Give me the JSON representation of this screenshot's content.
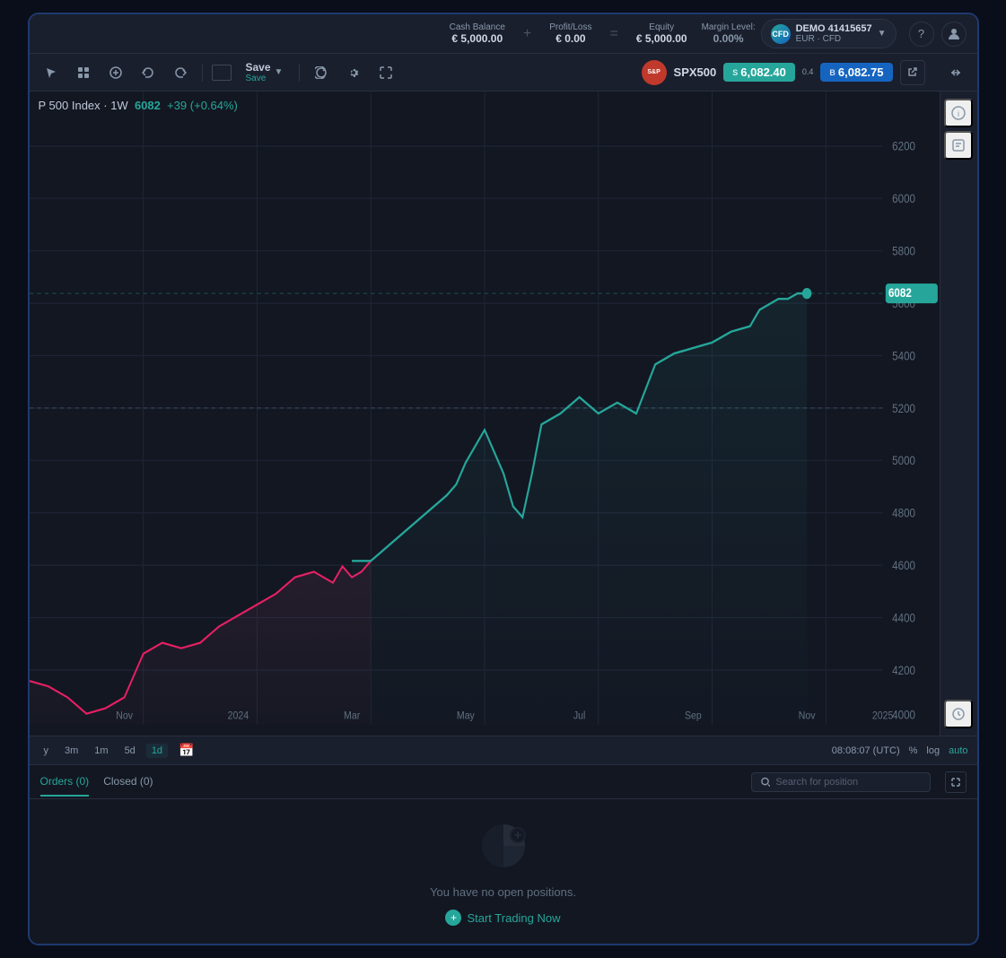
{
  "topbar": {
    "cash_balance_label": "Cash Balance",
    "cash_balance_value": "€ 5,000.00",
    "profit_loss_label": "Profit/Loss",
    "profit_loss_value": "€ 0.00",
    "equity_label": "Equity",
    "equity_value": "€ 5,000.00",
    "margin_level_label": "Margin Level:",
    "margin_level_value": "0.00%",
    "account_label": "DEMO 41415657",
    "account_sub": "EUR · CFD",
    "help_icon": "?",
    "user_icon": "👤"
  },
  "toolbar": {
    "save_label": "Save",
    "save_sub": "Save",
    "symbol": "SPX500",
    "spread": "0.4",
    "sell_label": "S",
    "sell_price": "6,082.40",
    "buy_label": "B",
    "buy_price": "6,082.75"
  },
  "chart": {
    "symbol_full": "P 500 Index · 1W",
    "price": "6082",
    "change": "+39 (+0.64%)",
    "current_price_box": "6082",
    "y_labels": [
      "6200",
      "6000",
      "5800",
      "5600",
      "5400",
      "5200",
      "5000",
      "4800",
      "4600",
      "4400",
      "4200",
      "4000"
    ],
    "x_labels": [
      "Nov",
      "2024",
      "Mar",
      "May",
      "Jul",
      "Sep",
      "Nov",
      "2025"
    ]
  },
  "timeline": {
    "intervals": [
      "y",
      "3m",
      "1m",
      "5d",
      "1d"
    ],
    "active_interval": "1d",
    "time_display": "08:08:07 (UTC)",
    "scale_pct": "%",
    "scale_log": "log",
    "scale_auto": "auto"
  },
  "bottom_panel": {
    "tabs": [
      {
        "label": "Orders (0)",
        "active": true
      },
      {
        "label": "Closed (0)",
        "active": false
      }
    ],
    "search_placeholder": "Search for position",
    "empty_text": "You have no open positions.",
    "start_trading": "Start Trading Now"
  }
}
